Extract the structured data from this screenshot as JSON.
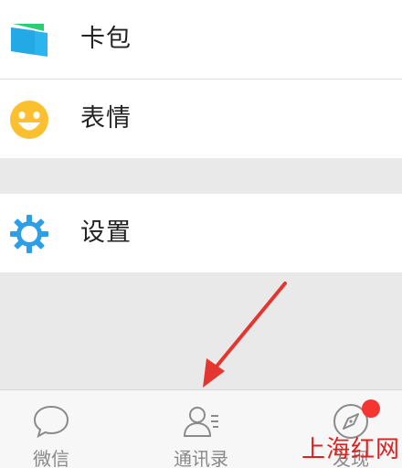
{
  "menu": {
    "items": [
      {
        "label": "卡包",
        "icon": "wallet-icon",
        "color": "#2ab5ef"
      },
      {
        "label": "表情",
        "icon": "smiley-icon",
        "color": "#fbc02d"
      },
      {
        "label": "设置",
        "icon": "gear-icon",
        "color": "#2e9fe6"
      }
    ]
  },
  "tabbar": {
    "tabs": [
      {
        "label": "微信",
        "icon": "chat-bubble-icon"
      },
      {
        "label": "通讯录",
        "icon": "contacts-icon"
      },
      {
        "label": "发现",
        "icon": "compass-icon"
      }
    ],
    "badge_color": "#f43530"
  },
  "annotation": {
    "arrow_color": "#e4352f"
  },
  "watermark": {
    "text": "上海红网"
  }
}
